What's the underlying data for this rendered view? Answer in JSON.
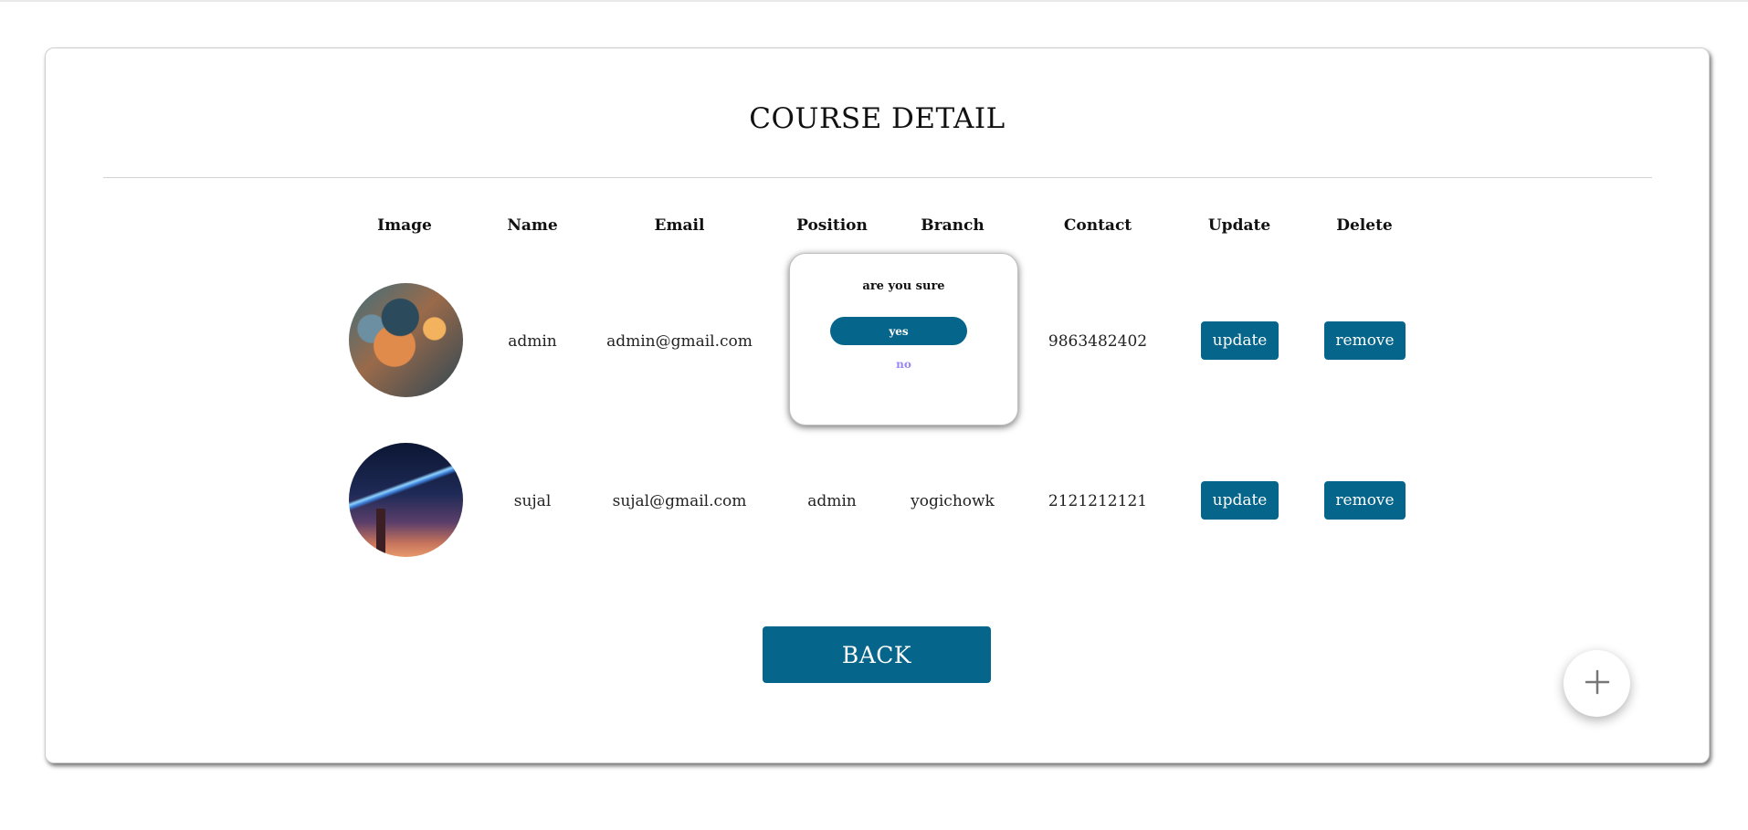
{
  "page": {
    "title": "COURSE DETAIL",
    "back_label": "BACK",
    "fab_icon": "plus-icon"
  },
  "table": {
    "headers": [
      "Image",
      "Name",
      "Email",
      "Position",
      "Branch",
      "Contact",
      "Update",
      "Delete"
    ],
    "rows": [
      {
        "image": "avatar-anime-boy-headphones",
        "name": "admin",
        "email": "admin@gmail.com",
        "position": "",
        "branch": "",
        "contact": "9863482402",
        "update_label": "update",
        "delete_label": "remove"
      },
      {
        "image": "avatar-comet-night-sky",
        "name": "sujal",
        "email": "sujal@gmail.com",
        "position": "admin",
        "branch": "yogichowk",
        "contact": "2121212121",
        "update_label": "update",
        "delete_label": "remove"
      }
    ]
  },
  "confirm_dialog": {
    "message": "are you sure",
    "yes_label": "yes",
    "no_label": "no"
  },
  "colors": {
    "primary": "#05658a",
    "no_link": "#9b87f5"
  }
}
